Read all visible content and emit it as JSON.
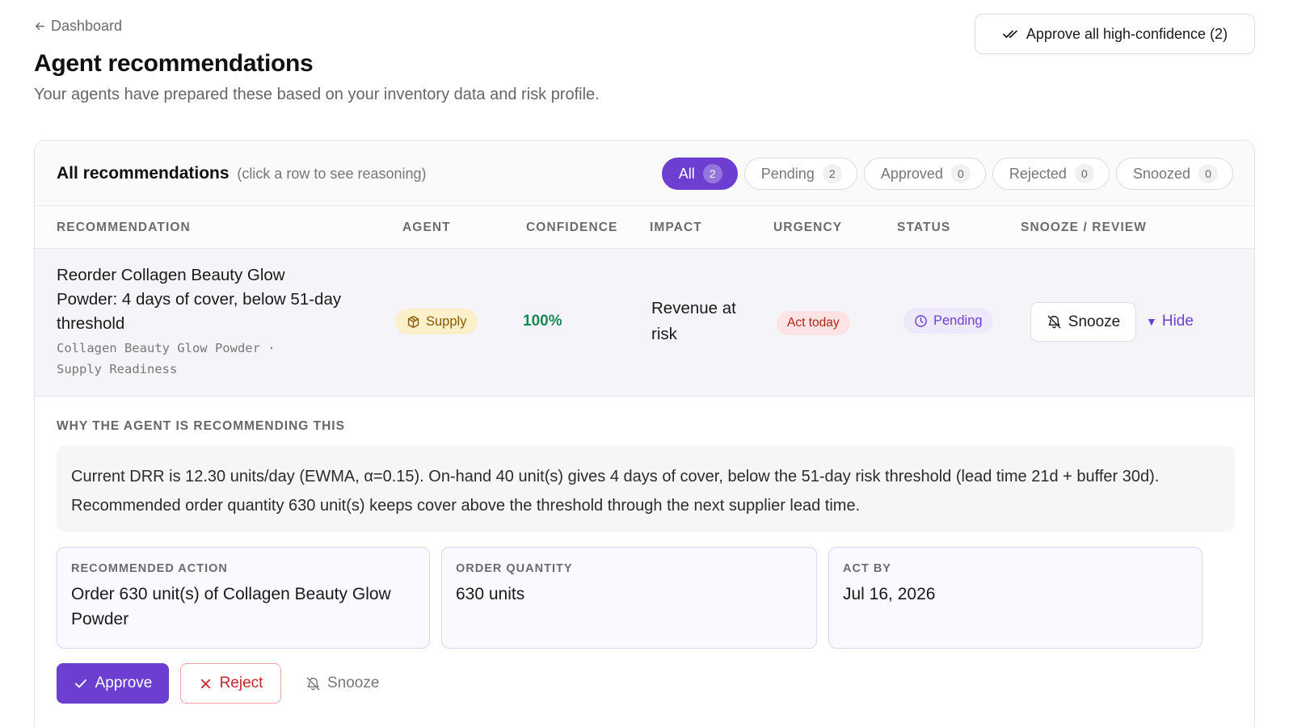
{
  "nav": {
    "back_label": "Dashboard"
  },
  "page": {
    "title": "Agent recommendations",
    "subtitle": "Your agents have prepared these based on your inventory data and risk profile."
  },
  "approve_all": {
    "label": "Approve all high-confidence (2)"
  },
  "panel": {
    "title": "All recommendations",
    "hint": "(click a row to see reasoning)",
    "filters": [
      {
        "label": "All",
        "count": "2",
        "active": true
      },
      {
        "label": "Pending",
        "count": "2",
        "active": false
      },
      {
        "label": "Approved",
        "count": "0",
        "active": false
      },
      {
        "label": "Rejected",
        "count": "0",
        "active": false
      },
      {
        "label": "Snoozed",
        "count": "0",
        "active": false
      }
    ]
  },
  "table": {
    "columns": [
      "RECOMMENDATION",
      "AGENT",
      "CONFIDENCE",
      "IMPACT",
      "URGENCY",
      "STATUS",
      "SNOOZE / REVIEW"
    ],
    "rows": [
      {
        "title": "Reorder Collagen Beauty Glow Powder: 4 days of cover, below 51-day threshold",
        "meta": "Collagen Beauty Glow Powder · Supply Readiness",
        "agent": "Supply",
        "agent_icon": "package-icon",
        "confidence": "100%",
        "impact": "Revenue at risk",
        "urgency": "Act today",
        "status": "Pending",
        "status_icon": "clock-icon",
        "snooze_label": "Snooze",
        "hide_label": "Hide"
      }
    ]
  },
  "detail": {
    "heading": "WHY THE AGENT IS RECOMMENDING THIS",
    "reasoning": "Current DRR is 12.30 units/day (EWMA, α=0.15). On-hand 40 unit(s) gives 4 days of cover, below the 51-day risk threshold (lead time 21d + buffer 30d). Recommended order quantity 630 unit(s) keeps cover above the threshold through the next supplier lead time.",
    "boxes": [
      {
        "label": "RECOMMENDED ACTION",
        "value": "Order 630 unit(s) of Collagen Beauty Glow Powder"
      },
      {
        "label": "ORDER QUANTITY",
        "value": "630 units"
      },
      {
        "label": "ACT BY",
        "value": "Jul 16, 2026"
      }
    ],
    "actions": {
      "approve": "Approve",
      "reject": "Reject",
      "snooze": "Snooze"
    }
  },
  "colors": {
    "accent": "#6d3fd1",
    "confidence": "#1a8a55",
    "urgency_bg": "#fde3e3",
    "urgency_text": "#b42318",
    "agent_bg": "#fbf0c9",
    "agent_text": "#8a5a00"
  }
}
